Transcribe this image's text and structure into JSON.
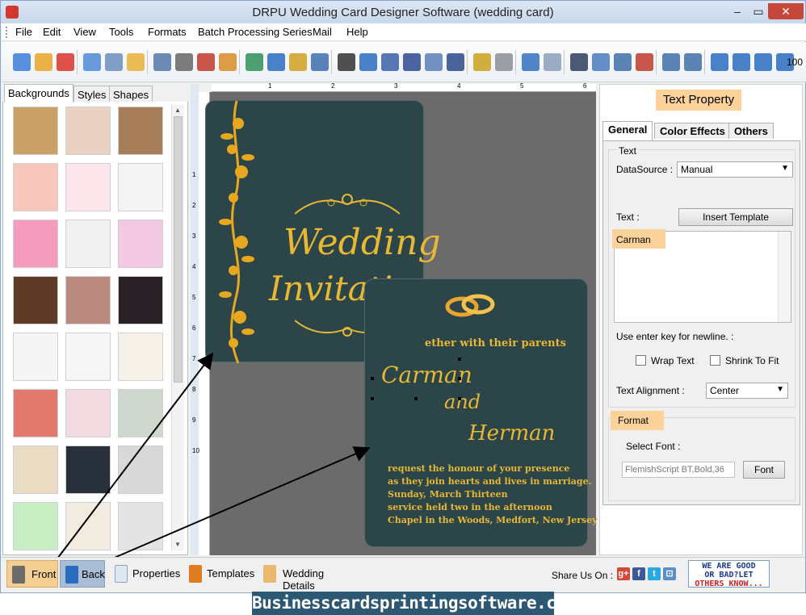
{
  "window": {
    "title": "DRPU Wedding Card Designer Software (wedding card)",
    "controls": {
      "minimize": "–",
      "maximize": "▭",
      "close": "✕"
    }
  },
  "menu": [
    "File",
    "Edit",
    "View",
    "Tools",
    "Formats",
    "Batch Processing Series",
    "Mail",
    "Help"
  ],
  "toolbar": {
    "zoom_label": "100",
    "icons": [
      "new-icon",
      "open-icon",
      "close-icon",
      "save-icon",
      "save-as-icon",
      "export-icon",
      "print-preview-icon",
      "print-icon",
      "copies-icon",
      "gift-icon",
      "image-icon",
      "pencil-icon",
      "shape-icon",
      "watermark-icon",
      "barcode-icon",
      "text-icon",
      "word-art-icon",
      "signature-icon",
      "email-icon",
      "line-icon",
      "database-icon",
      "batch-icon",
      "undo-icon",
      "redo-icon",
      "cut-icon",
      "copy-icon",
      "paste-icon",
      "delete-icon",
      "bring-front-icon",
      "send-back-icon",
      "grid-icon",
      "actual-size-icon",
      "fit-window-icon",
      "zoom-in-icon"
    ]
  },
  "left_panel": {
    "tabs": [
      "Backgrounds",
      "Styles",
      "Shapes"
    ],
    "active_tab": "Backgrounds",
    "thumbnail_colors": [
      [
        "#c9a066",
        "#e9d2c1",
        "#a67e5a"
      ],
      [
        "#f7c7bb",
        "#fce6ec",
        "#f4f4f4"
      ],
      [
        "#f59bbd",
        "#f1f1f1",
        "#f3c8e2"
      ],
      [
        "#5e3a27",
        "#b98a7d",
        "#2a2126"
      ],
      [
        "#f5f5f5",
        "#f6f6f6",
        "#f6f2e8"
      ],
      [
        "#e3786e",
        "#f3dbe1",
        "#cfd8cf"
      ],
      [
        "#e9dcc3",
        "#27303b",
        "#d8d8d8"
      ],
      [
        "#c8eec4",
        "#f1ebe0",
        "#e4e4e4"
      ]
    ]
  },
  "card_front": {
    "line1": "Wedding",
    "line2": "Invitation"
  },
  "card_back": {
    "intro": "ether with their parents",
    "bride": "Carman",
    "and": "and",
    "groom": "Herman",
    "details": [
      "request the honour of your presence",
      "as they join hearts and lives in marriage.",
      "Sunday, March Thirteen",
      "service held two in the afternoon",
      "Chapel in the Woods, Medfort, New Jersey"
    ]
  },
  "ruler": {
    "h_ticks": [
      "1",
      "2",
      "3",
      "4",
      "5",
      "6"
    ],
    "v_ticks": [
      "1",
      "2",
      "3",
      "4",
      "5",
      "6",
      "7",
      "8",
      "9",
      "10"
    ]
  },
  "right_panel": {
    "title": "Text Property",
    "tabs": [
      "General",
      "Color Effects",
      "Others"
    ],
    "active_tab": "General",
    "group_text": "Text",
    "datasource_label": "DataSource :",
    "datasource_value": "Manual",
    "text_label": "Text :",
    "insert_template": "Insert Template",
    "text_value": "Carman",
    "newline_hint": "Use enter key for newline. :",
    "wrap_text": "Wrap Text",
    "shrink_to_fit": "Shrink To Fit",
    "alignment_label": "Text Alignment :",
    "alignment_value": "Center",
    "format_label": "Format",
    "select_font_label": "Select Font :",
    "font_value": "FlemishScript BT,Bold,36",
    "font_button": "Font"
  },
  "bottom_bar": {
    "buttons": [
      "Front",
      "Back",
      "Properties",
      "Templates",
      "Wedding Details"
    ],
    "active": "Front",
    "share_label": "Share Us On :",
    "social": [
      "g+",
      "f",
      "t",
      "⊡"
    ],
    "feedback_line1": "WE ARE GOOD",
    "feedback_line2": "OR BAD?LET",
    "feedback_line3": "OTHERS KNOW..."
  },
  "banner": "Businesscardsprintingsoftware.com",
  "colors": {
    "card": "#2c4549",
    "gold": "#e7b833",
    "highlight": "#fbd39a",
    "canvas": "#6b6b6b"
  }
}
